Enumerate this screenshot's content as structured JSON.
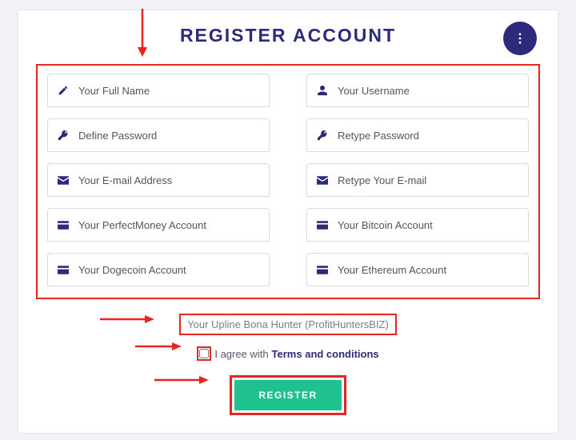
{
  "header": {
    "title": "REGISTER ACCOUNT"
  },
  "fields": {
    "full_name": "Your Full Name",
    "username": "Your Username",
    "password": "Define Password",
    "retype_password": "Retype Password",
    "email": "Your E-mail Address",
    "retype_email": "Retype Your E-mail",
    "perfectmoney": "Your PerfectMoney Account",
    "bitcoin": "Your Bitcoin Account",
    "dogecoin": "Your Dogecoin Account",
    "ethereum": "Your Ethereum Account"
  },
  "upline_text": "Your Upline Bona Hunter (ProfitHuntersBIZ)",
  "agree": {
    "prefix": "I agree with ",
    "link": "Terms and conditions"
  },
  "buttons": {
    "register": "REGISTER"
  }
}
